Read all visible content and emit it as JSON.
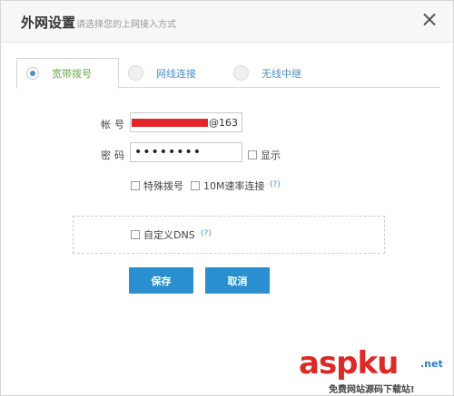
{
  "dialog": {
    "title": "外网设置",
    "subtitle": "请选择您的上网接入方式"
  },
  "tabs": [
    {
      "label": "宽带拨号",
      "selected": true
    },
    {
      "label": "网线连接",
      "selected": false
    },
    {
      "label": "无线中继",
      "selected": false
    }
  ],
  "form": {
    "account_label": "帐号",
    "account_suffix": "@163",
    "password_label": "密码",
    "password_masked": "••••••••",
    "show_label": "显示",
    "special_dial_label": "特殊拨号",
    "rate_10m_label": "10M速率连接",
    "help_text": "(?)",
    "custom_dns_label": "自定义DNS",
    "dns_help_text": "(?)"
  },
  "buttons": {
    "save_label": "保存",
    "cancel_label": "取消"
  },
  "watermark": {
    "main": "aspku",
    "net": ".net",
    "sub": "免费网站源码下载站!"
  },
  "colors": {
    "accent": "#2a8fd0",
    "redaction": "#e3262a",
    "active_tab_text": "#6aa84f"
  }
}
